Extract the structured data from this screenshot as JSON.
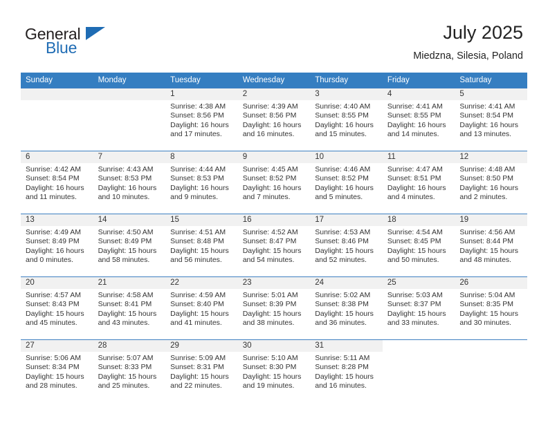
{
  "brand": {
    "name_part1": "General",
    "name_part2": "Blue",
    "logo_icon": "triangle-sail-icon",
    "accent_color": "#1f6cb4"
  },
  "header": {
    "title": "July 2025",
    "subtitle": "Miedzna, Silesia, Poland"
  },
  "calendar": {
    "header_bg": "#357ec1",
    "daynum_band_bg": "#f1f1f1",
    "grid_line_color": "#3d7fc1",
    "weekday_headers": [
      "Sunday",
      "Monday",
      "Tuesday",
      "Wednesday",
      "Thursday",
      "Friday",
      "Saturday"
    ],
    "weeks": [
      [
        {
          "day": "",
          "lines": []
        },
        {
          "day": "",
          "lines": []
        },
        {
          "day": "1",
          "lines": [
            "Sunrise: 4:38 AM",
            "Sunset: 8:56 PM",
            "Daylight: 16 hours",
            "and 17 minutes."
          ]
        },
        {
          "day": "2",
          "lines": [
            "Sunrise: 4:39 AM",
            "Sunset: 8:56 PM",
            "Daylight: 16 hours",
            "and 16 minutes."
          ]
        },
        {
          "day": "3",
          "lines": [
            "Sunrise: 4:40 AM",
            "Sunset: 8:55 PM",
            "Daylight: 16 hours",
            "and 15 minutes."
          ]
        },
        {
          "day": "4",
          "lines": [
            "Sunrise: 4:41 AM",
            "Sunset: 8:55 PM",
            "Daylight: 16 hours",
            "and 14 minutes."
          ]
        },
        {
          "day": "5",
          "lines": [
            "Sunrise: 4:41 AM",
            "Sunset: 8:54 PM",
            "Daylight: 16 hours",
            "and 13 minutes."
          ]
        }
      ],
      [
        {
          "day": "6",
          "lines": [
            "Sunrise: 4:42 AM",
            "Sunset: 8:54 PM",
            "Daylight: 16 hours",
            "and 11 minutes."
          ]
        },
        {
          "day": "7",
          "lines": [
            "Sunrise: 4:43 AM",
            "Sunset: 8:53 PM",
            "Daylight: 16 hours",
            "and 10 minutes."
          ]
        },
        {
          "day": "8",
          "lines": [
            "Sunrise: 4:44 AM",
            "Sunset: 8:53 PM",
            "Daylight: 16 hours",
            "and 9 minutes."
          ]
        },
        {
          "day": "9",
          "lines": [
            "Sunrise: 4:45 AM",
            "Sunset: 8:52 PM",
            "Daylight: 16 hours",
            "and 7 minutes."
          ]
        },
        {
          "day": "10",
          "lines": [
            "Sunrise: 4:46 AM",
            "Sunset: 8:52 PM",
            "Daylight: 16 hours",
            "and 5 minutes."
          ]
        },
        {
          "day": "11",
          "lines": [
            "Sunrise: 4:47 AM",
            "Sunset: 8:51 PM",
            "Daylight: 16 hours",
            "and 4 minutes."
          ]
        },
        {
          "day": "12",
          "lines": [
            "Sunrise: 4:48 AM",
            "Sunset: 8:50 PM",
            "Daylight: 16 hours",
            "and 2 minutes."
          ]
        }
      ],
      [
        {
          "day": "13",
          "lines": [
            "Sunrise: 4:49 AM",
            "Sunset: 8:49 PM",
            "Daylight: 16 hours",
            "and 0 minutes."
          ]
        },
        {
          "day": "14",
          "lines": [
            "Sunrise: 4:50 AM",
            "Sunset: 8:49 PM",
            "Daylight: 15 hours",
            "and 58 minutes."
          ]
        },
        {
          "day": "15",
          "lines": [
            "Sunrise: 4:51 AM",
            "Sunset: 8:48 PM",
            "Daylight: 15 hours",
            "and 56 minutes."
          ]
        },
        {
          "day": "16",
          "lines": [
            "Sunrise: 4:52 AM",
            "Sunset: 8:47 PM",
            "Daylight: 15 hours",
            "and 54 minutes."
          ]
        },
        {
          "day": "17",
          "lines": [
            "Sunrise: 4:53 AM",
            "Sunset: 8:46 PM",
            "Daylight: 15 hours",
            "and 52 minutes."
          ]
        },
        {
          "day": "18",
          "lines": [
            "Sunrise: 4:54 AM",
            "Sunset: 8:45 PM",
            "Daylight: 15 hours",
            "and 50 minutes."
          ]
        },
        {
          "day": "19",
          "lines": [
            "Sunrise: 4:56 AM",
            "Sunset: 8:44 PM",
            "Daylight: 15 hours",
            "and 48 minutes."
          ]
        }
      ],
      [
        {
          "day": "20",
          "lines": [
            "Sunrise: 4:57 AM",
            "Sunset: 8:43 PM",
            "Daylight: 15 hours",
            "and 45 minutes."
          ]
        },
        {
          "day": "21",
          "lines": [
            "Sunrise: 4:58 AM",
            "Sunset: 8:41 PM",
            "Daylight: 15 hours",
            "and 43 minutes."
          ]
        },
        {
          "day": "22",
          "lines": [
            "Sunrise: 4:59 AM",
            "Sunset: 8:40 PM",
            "Daylight: 15 hours",
            "and 41 minutes."
          ]
        },
        {
          "day": "23",
          "lines": [
            "Sunrise: 5:01 AM",
            "Sunset: 8:39 PM",
            "Daylight: 15 hours",
            "and 38 minutes."
          ]
        },
        {
          "day": "24",
          "lines": [
            "Sunrise: 5:02 AM",
            "Sunset: 8:38 PM",
            "Daylight: 15 hours",
            "and 36 minutes."
          ]
        },
        {
          "day": "25",
          "lines": [
            "Sunrise: 5:03 AM",
            "Sunset: 8:37 PM",
            "Daylight: 15 hours",
            "and 33 minutes."
          ]
        },
        {
          "day": "26",
          "lines": [
            "Sunrise: 5:04 AM",
            "Sunset: 8:35 PM",
            "Daylight: 15 hours",
            "and 30 minutes."
          ]
        }
      ],
      [
        {
          "day": "27",
          "lines": [
            "Sunrise: 5:06 AM",
            "Sunset: 8:34 PM",
            "Daylight: 15 hours",
            "and 28 minutes."
          ]
        },
        {
          "day": "28",
          "lines": [
            "Sunrise: 5:07 AM",
            "Sunset: 8:33 PM",
            "Daylight: 15 hours",
            "and 25 minutes."
          ]
        },
        {
          "day": "29",
          "lines": [
            "Sunrise: 5:09 AM",
            "Sunset: 8:31 PM",
            "Daylight: 15 hours",
            "and 22 minutes."
          ]
        },
        {
          "day": "30",
          "lines": [
            "Sunrise: 5:10 AM",
            "Sunset: 8:30 PM",
            "Daylight: 15 hours",
            "and 19 minutes."
          ]
        },
        {
          "day": "31",
          "lines": [
            "Sunrise: 5:11 AM",
            "Sunset: 8:28 PM",
            "Daylight: 15 hours",
            "and 16 minutes."
          ]
        },
        {
          "day": "",
          "lines": []
        },
        {
          "day": "",
          "lines": []
        }
      ]
    ]
  }
}
